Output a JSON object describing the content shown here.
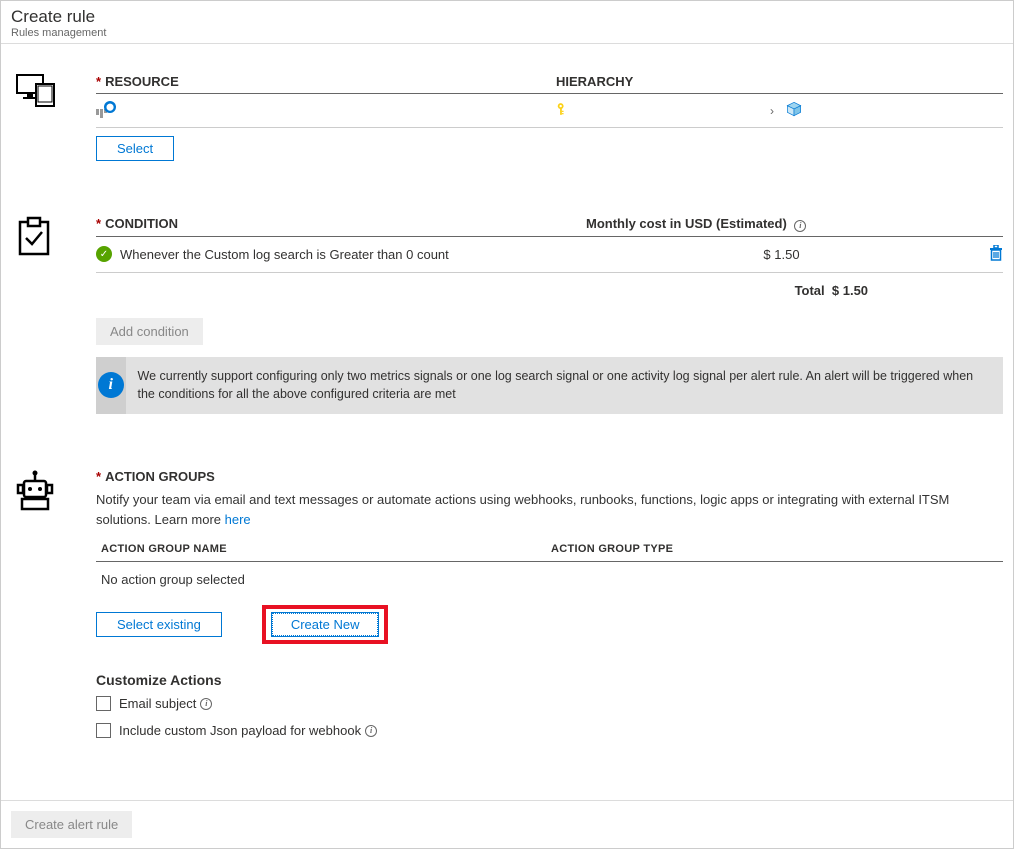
{
  "header": {
    "title": "Create rule",
    "subtitle": "Rules management"
  },
  "resource": {
    "label_resource": "RESOURCE",
    "label_hierarchy": "HIERARCHY",
    "select_button": "Select"
  },
  "condition": {
    "label": "CONDITION",
    "cost_label": "Monthly cost in USD (Estimated)",
    "item_text": "Whenever the Custom log search is Greater than 0 count",
    "item_cost": "$ 1.50",
    "total_label": "Total",
    "total_value": "$ 1.50",
    "add_button": "Add condition",
    "info_text": "We currently support configuring only two metrics signals or one log search signal or one activity log signal per alert rule. An alert will be triggered when the conditions for all the above configured criteria are met"
  },
  "action_groups": {
    "label": "ACTION GROUPS",
    "desc": "Notify your team via email and text messages or automate actions using webhooks, runbooks, functions, logic apps or integrating with external ITSM solutions. Learn more ",
    "learn_more": "here",
    "col_name": "ACTION GROUP NAME",
    "col_type": "ACTION GROUP TYPE",
    "empty": "No action group selected",
    "select_existing": "Select existing",
    "create_new": "Create New",
    "customize_label": "Customize Actions",
    "chk_email": "Email subject",
    "chk_json": "Include custom Json payload for webhook"
  },
  "footer": {
    "create_button": "Create alert rule"
  }
}
